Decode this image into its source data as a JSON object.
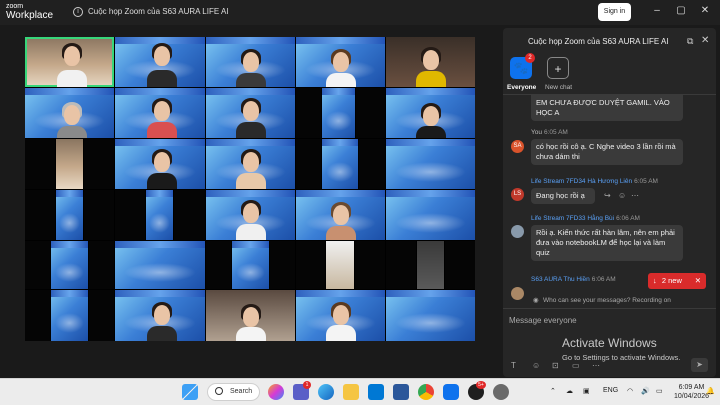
{
  "app": {
    "logo_line1": "zoom",
    "logo_line2": "Workplace",
    "window_title": "Cuộc họp Zoom của S63 AURA LIFE AI",
    "signin_label": "Sign in",
    "window_controls": [
      "–",
      "▢",
      "✕"
    ]
  },
  "chat": {
    "title": "Cuộc họp Zoom của S63 AURA LIFE AI",
    "tabs": [
      {
        "label": "Everyone",
        "badge": "2",
        "icon": "paw-icon"
      },
      {
        "label": "New chat",
        "icon": "plus-icon"
      }
    ],
    "messages": [
      {
        "sender": "",
        "time": "",
        "text": "EM CHƯA ĐƯỢC DUYỆT GAMIL. VÀO HỌC A",
        "avatar": ""
      },
      {
        "sender": "You",
        "time": "6:05 AM",
        "text": "có học rồi cô ạ. C Nghe video 3 lần rồi mà chưa dám thi",
        "avatar": "SA",
        "avatar_color": "#d9532b"
      },
      {
        "sender": "Life Stream 7FD34 Hà Hương Liên",
        "time": "6:05 AM",
        "text": "Đang học rồi ạ",
        "avatar": "LS",
        "avatar_color": "#c0392b"
      },
      {
        "sender": "Life Stream 7FD33 Hằng Bùi",
        "time": "6:06 AM",
        "text": "Rồi ạ. Kiến thức rất hàn lâm, nên em phải đưa vào notebookLM để học lại và làm quiz",
        "avatar": "",
        "avatar_color": "#8899aa"
      },
      {
        "sender": "S63 AURA Thu Hiền",
        "time": "6:06 AM",
        "text": "",
        "avatar": "",
        "avatar_color": "#aa8866"
      }
    ],
    "new_messages_label": "2 new",
    "recording_note": "Who can see your messages? Recording on",
    "input_placeholder": "Message everyone"
  },
  "watermark": {
    "line1": "Activate Windows",
    "line2": "Go to Settings to activate Windows."
  },
  "taskbar": {
    "search_label": "Search",
    "language": "ENG",
    "time": "6:09 AM",
    "date": "10/04/2026",
    "badge_teams": "1",
    "badge_app": "5+"
  },
  "colors": {
    "zoom_blue": "#0e72ed",
    "link_blue": "#5aa0f5",
    "new_badge_red": "#d92b2b",
    "active_speaker_green": "#37d67a"
  }
}
